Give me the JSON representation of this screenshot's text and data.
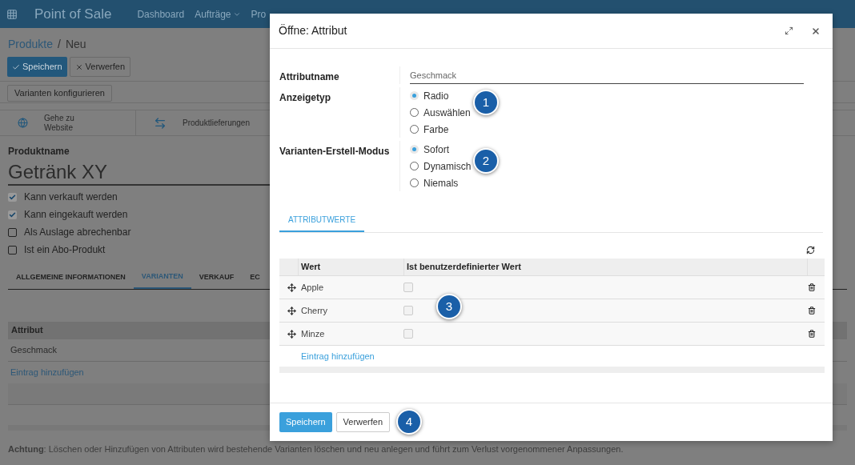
{
  "navbar": {
    "app_title": "Point of Sale",
    "menus": [
      {
        "label": "Dashboard",
        "dropdown": false
      },
      {
        "label": "Aufträge",
        "dropdown": true
      },
      {
        "label": "Pro",
        "dropdown": false
      }
    ]
  },
  "breadcrumb": {
    "parent": "Produkte",
    "separator": "/",
    "current": "Neu"
  },
  "form_buttons": [
    {
      "label": "Speichern",
      "kind": "primary"
    },
    {
      "label": "Verwerfen",
      "kind": "secondary"
    }
  ],
  "configure_button": "Varianten konfigurieren",
  "smart_buttons": [
    {
      "label": "Gehe zu Website",
      "kind": "globe"
    },
    {
      "label": "Produktlieferungen",
      "kind": "transfer"
    }
  ],
  "product": {
    "name_label": "Produktname",
    "name": "Getränk XY",
    "options": [
      {
        "label": "Kann verkauft werden",
        "checked": true
      },
      {
        "label": "Kann eingekauft werden",
        "checked": true
      },
      {
        "label": "Als Auslage abrechenbar",
        "checked": false
      },
      {
        "label": "Ist ein Abo-Produkt",
        "checked": false
      }
    ]
  },
  "tabs": [
    {
      "label": "ALLGEMEINE INFORMATIONEN",
      "selected": false
    },
    {
      "label": "VARIANTEN",
      "selected": true
    },
    {
      "label": "VERKAUF",
      "selected": false
    },
    {
      "label": "EC",
      "selected": false
    }
  ],
  "attribute_table": {
    "column": "Attribut",
    "rows": [
      "Geschmack"
    ],
    "add_link": "Eintrag hinzufügen"
  },
  "warning": "**Achtung**: Löschen oder Hinzufügen von Attributen wird bestehende Varianten löschen und neu anlegen und führt zum Verlust vorgenommener Anpassungen.",
  "dialog": {
    "title": "Öffne: Attribut",
    "attribute_name": {
      "label": "Attributname",
      "value": "Geschmack"
    },
    "radio_groups": [
      {
        "label": "Anzeigetyp",
        "options": [
          {
            "label": "Radio",
            "selected": true
          },
          {
            "label": "Auswählen",
            "selected": false
          },
          {
            "label": "Farbe",
            "selected": false
          }
        ]
      },
      {
        "label": "Varianten-Erstell-Modus",
        "options": [
          {
            "label": "Sofort",
            "selected": true
          },
          {
            "label": "Dynamisch",
            "selected": false
          },
          {
            "label": "Niemals",
            "selected": false
          }
        ]
      }
    ],
    "tabs": [
      {
        "label": "ATTRIBUTWERTE",
        "selected": true
      }
    ],
    "values_table": {
      "columns": [
        "Wert",
        "Ist benutzerdefinierter Wert"
      ],
      "rows": [
        {
          "value": "Apple",
          "custom": false
        },
        {
          "value": "Cherry",
          "custom": false
        },
        {
          "value": "Minze",
          "custom": false
        }
      ],
      "add_link": "Eintrag hinzufügen"
    },
    "footer_buttons": [
      {
        "label": "Speichern",
        "kind": "primary"
      },
      {
        "label": "Verwerfen",
        "kind": "secondary"
      }
    ],
    "markers": [
      "1",
      "2",
      "3",
      "4"
    ]
  }
}
